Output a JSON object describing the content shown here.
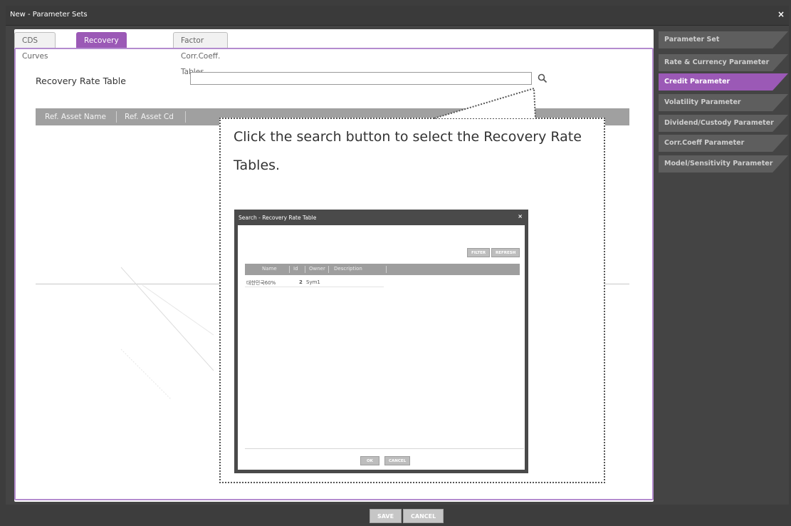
{
  "window": {
    "title": "New - Parameter Sets",
    "close_glyph": "×"
  },
  "tabs": [
    {
      "label": "CDS Curves"
    },
    {
      "label": "Recovery Rate Tables",
      "active": true
    },
    {
      "label": "Factor Corr.Coeff. Tables"
    }
  ],
  "form": {
    "recovery_label": "Recovery Rate Table",
    "recovery_value": "",
    "search_icon": "search-icon"
  },
  "grid": {
    "columns": [
      "Ref. Asset Name",
      "Ref. Asset Cd"
    ]
  },
  "sidenav": {
    "items": [
      {
        "label": "Parameter Set"
      },
      {
        "label": "Rate & Currency Parameter"
      },
      {
        "label": "Credit Parameter",
        "active": true
      },
      {
        "label": "Volatility Parameter"
      },
      {
        "label": "Dividend/Custody Parameter"
      },
      {
        "label": "Corr.Coeff Parameter"
      },
      {
        "label": "Model/Sensitivity Parameter"
      }
    ]
  },
  "callout": {
    "text": "Click the search button to select the Recovery Rate Tables."
  },
  "dialog": {
    "title": "Search - Recovery Rate Table",
    "close_glyph": "×",
    "filter_label": "FILTER",
    "refresh_label": "REFRESH",
    "columns": [
      "Name",
      "Id",
      "Owner",
      "Description"
    ],
    "rows": [
      {
        "name": "대한민국60%",
        "id": "2",
        "owner": "Sym1",
        "description": ""
      }
    ],
    "ok_label": "OK",
    "cancel_label": "CANCEL"
  },
  "footer": {
    "save_label": "SAVE",
    "cancel_label": "CANCEL"
  },
  "colors": {
    "accent": "#9b59b6",
    "frame": "#444444",
    "header_gray": "#a0a0a0"
  }
}
